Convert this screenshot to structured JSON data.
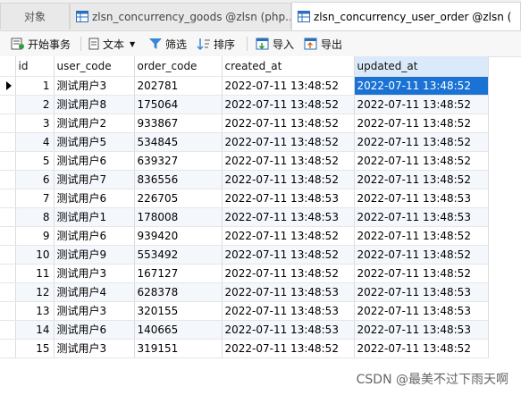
{
  "tabs": [
    {
      "label": "对象"
    },
    {
      "label": "zlsn_concurrency_goods @zlsn (php..."
    },
    {
      "label": "zlsn_concurrency_user_order @zlsn ("
    }
  ],
  "toolbar": {
    "begin_transaction": "开始事务",
    "text": "文本",
    "filter": "筛选",
    "sort": "排序",
    "import": "导入",
    "export": "导出"
  },
  "grid": {
    "columns": [
      "id",
      "user_code",
      "order_code",
      "created_at",
      "updated_at"
    ],
    "rows": [
      [
        "1",
        "测试用户3",
        "202781",
        "2022-07-11 13:48:52",
        "2022-07-11 13:48:52"
      ],
      [
        "2",
        "测试用户8",
        "175064",
        "2022-07-11 13:48:52",
        "2022-07-11 13:48:52"
      ],
      [
        "3",
        "测试用户2",
        "933867",
        "2022-07-11 13:48:52",
        "2022-07-11 13:48:52"
      ],
      [
        "4",
        "测试用户5",
        "534845",
        "2022-07-11 13:48:52",
        "2022-07-11 13:48:52"
      ],
      [
        "5",
        "测试用户6",
        "639327",
        "2022-07-11 13:48:52",
        "2022-07-11 13:48:52"
      ],
      [
        "6",
        "测试用户7",
        "836556",
        "2022-07-11 13:48:52",
        "2022-07-11 13:48:52"
      ],
      [
        "7",
        "测试用户6",
        "226705",
        "2022-07-11 13:48:53",
        "2022-07-11 13:48:53"
      ],
      [
        "8",
        "测试用户1",
        "178008",
        "2022-07-11 13:48:53",
        "2022-07-11 13:48:53"
      ],
      [
        "9",
        "测试用户6",
        "939420",
        "2022-07-11 13:48:52",
        "2022-07-11 13:48:52"
      ],
      [
        "10",
        "测试用户9",
        "553492",
        "2022-07-11 13:48:52",
        "2022-07-11 13:48:52"
      ],
      [
        "11",
        "测试用户3",
        "167127",
        "2022-07-11 13:48:52",
        "2022-07-11 13:48:52"
      ],
      [
        "12",
        "测试用户4",
        "628378",
        "2022-07-11 13:48:53",
        "2022-07-11 13:48:53"
      ],
      [
        "13",
        "测试用户3",
        "320155",
        "2022-07-11 13:48:53",
        "2022-07-11 13:48:53"
      ],
      [
        "14",
        "测试用户6",
        "140665",
        "2022-07-11 13:48:53",
        "2022-07-11 13:48:53"
      ],
      [
        "15",
        "测试用户3",
        "319151",
        "2022-07-11 13:48:52",
        "2022-07-11 13:48:52"
      ]
    ]
  },
  "watermark": "CSDN @最美不过下雨天啊",
  "colors": {
    "selected_cell": "#1a73d4",
    "selected_header": "#dbeafa",
    "alt_row": "#f4f8fd",
    "table_icon": "#2a6ebd"
  }
}
